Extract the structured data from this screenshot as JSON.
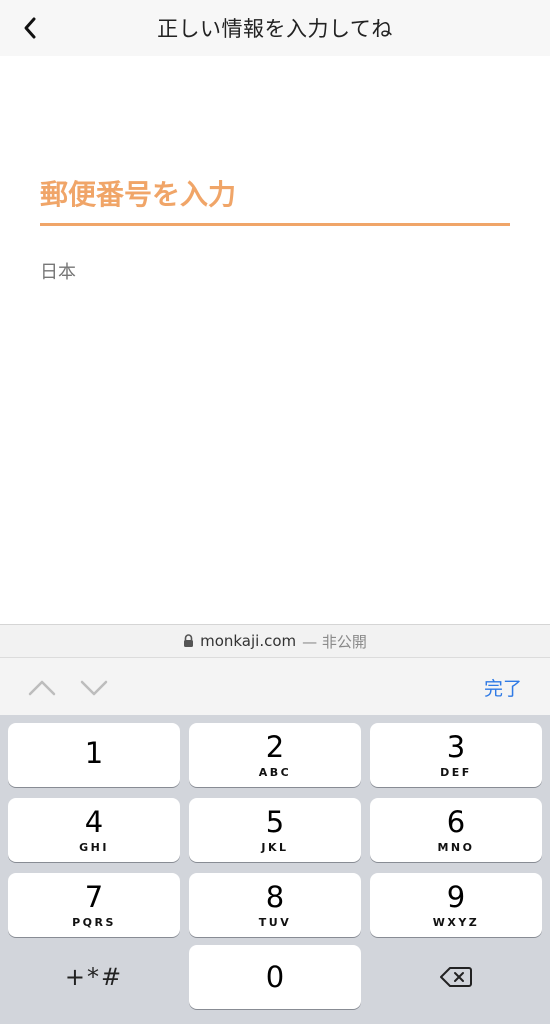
{
  "header": {
    "title": "正しい情報を入力してね",
    "back_icon": "chevron-left-icon"
  },
  "form": {
    "postal_placeholder": "郵便番号を入力",
    "postal_value": "",
    "country": "日本",
    "accent_color": "#f0a568"
  },
  "browser": {
    "domain": "monkaji.com",
    "suffix": "— 非公開",
    "lock_icon": "lock-icon"
  },
  "accessory": {
    "up_icon": "chevron-up-icon",
    "down_icon": "chevron-down-icon",
    "done_label": "完了",
    "done_color": "#2f7ae5"
  },
  "keypad": {
    "keys": [
      {
        "num": "1",
        "letters": ""
      },
      {
        "num": "2",
        "letters": "ABC"
      },
      {
        "num": "3",
        "letters": "DEF"
      },
      {
        "num": "4",
        "letters": "GHI"
      },
      {
        "num": "5",
        "letters": "JKL"
      },
      {
        "num": "6",
        "letters": "MNO"
      },
      {
        "num": "7",
        "letters": "PQRS"
      },
      {
        "num": "8",
        "letters": "TUV"
      },
      {
        "num": "9",
        "letters": "WXYZ"
      }
    ],
    "symbols_label": "+*#",
    "zero": "0",
    "delete_icon": "backspace-icon"
  }
}
